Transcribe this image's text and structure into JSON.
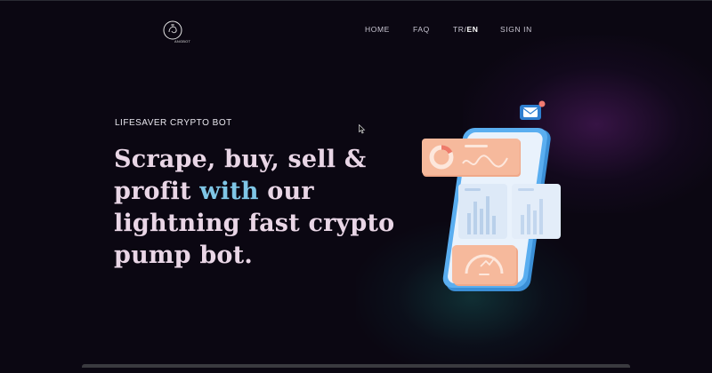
{
  "header": {
    "logo_text": "ANGBOT"
  },
  "nav": {
    "home": "HOME",
    "faq": "FAQ",
    "lang_tr": "TR/",
    "lang_en": "EN",
    "signin": "SIGN IN"
  },
  "hero": {
    "eyebrow": "LIFESAVER CRYPTO BOT",
    "headline_part1": "Scrape, buy, sell & profit ",
    "headline_highlight": "with",
    "headline_part2": " our lightning fast crypto pump bot."
  },
  "colors": {
    "background": "#0b0712",
    "headline": "#e9d6e6",
    "highlight": "#7fc6e6",
    "card_orange": "#f4b89a",
    "card_blue": "#dbe8f7",
    "phone_blue": "#4aa7e6"
  },
  "icons": [
    "logo-icon",
    "mail-icon",
    "cursor-icon",
    "donut-chart-icon",
    "bar-chart-icon",
    "gauge-icon"
  ]
}
